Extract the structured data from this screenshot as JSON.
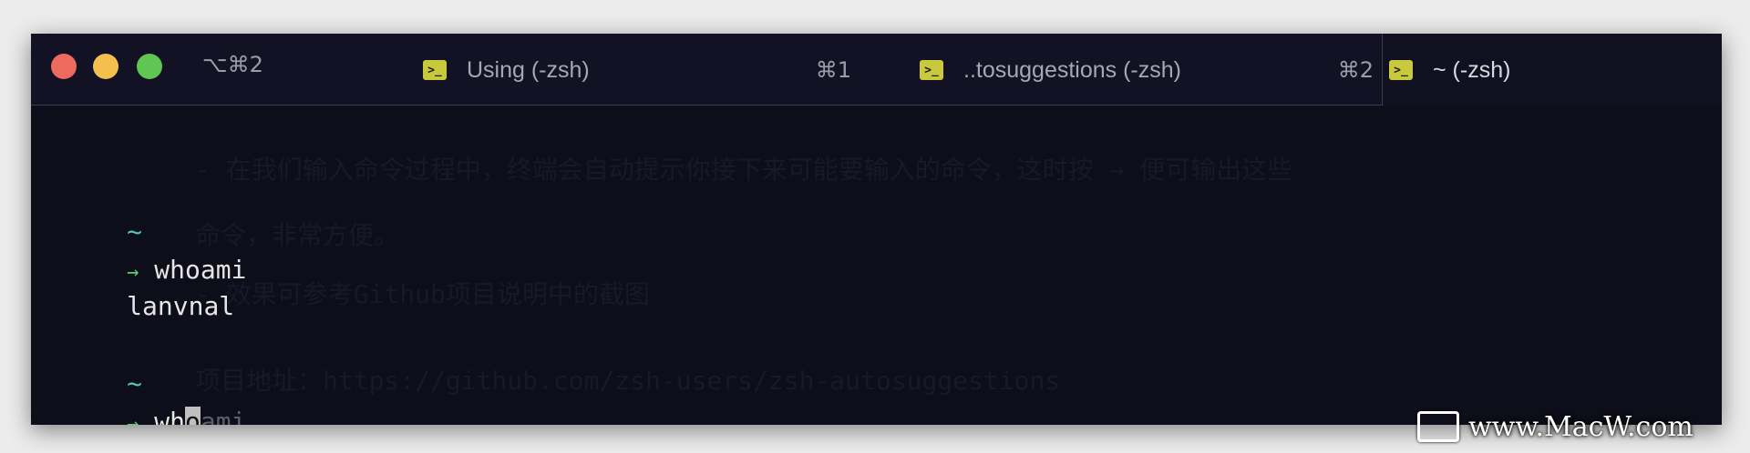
{
  "window": {
    "shortcut": "⌥⌘2"
  },
  "tabs": [
    {
      "title": "Using (-zsh)",
      "key": "⌘1",
      "icon": "terminal-icon"
    },
    {
      "title": "..tosuggestions (-zsh)",
      "key": "⌘2",
      "icon": "terminal-icon"
    },
    {
      "title": "~ (-zsh)",
      "icon": "terminal-icon"
    }
  ],
  "terminal": {
    "lines": [
      {
        "tilde": "~"
      },
      {
        "prompt": "→",
        "command": "whoami"
      },
      {
        "output": "lanvnal"
      },
      {
        "tilde": "~"
      },
      {
        "prompt": "→",
        "typed": "wh",
        "cursor_char": "o",
        "suggestion": "ami"
      }
    ],
    "background_text": [
      "- 在我们输入命令过程中，终端会自动提示你接下来可能要输入的命令，这时按 → 便可输出这些",
      "命令，非常方便。",
      "- 效果可参考Github项目说明中的截图",
      "项目地址：https://github.com/zsh-users/zsh-autosuggestions"
    ]
  },
  "watermark": {
    "text": "www.MacW.com"
  },
  "colors": {
    "background": "#0e0e1a",
    "tilde": "#52c7c0",
    "prompt": "#57d26e",
    "suggestion": "#5d5d68",
    "tab_icon": "#c9c93e"
  }
}
